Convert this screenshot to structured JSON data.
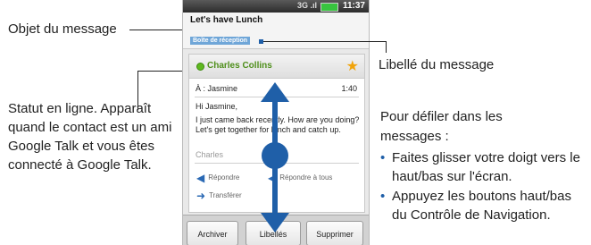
{
  "phone": {
    "status": {
      "clock": "11:37",
      "signal": "3G"
    },
    "subject": "Let's have Lunch",
    "label": "Boîte de réception",
    "sender": "Charles Collins",
    "to": "À : Jasmine",
    "time": "1:40",
    "greeting": "Hi Jasmine,",
    "body": "I just came back recently. How are you doing? Let's get together for lunch and catch up.",
    "signature": "Charles",
    "actions": {
      "reply": "Répondre",
      "reply_all": "Répondre à tous",
      "forward": "Transférer"
    },
    "buttons": {
      "archive": "Archiver",
      "labels": "Libellés",
      "delete": "Supprimer"
    }
  },
  "callouts": {
    "subject": "Objet du message",
    "label": "Libellé du message",
    "status": "Statut en ligne. Apparaît quand le contact est un ami Google Talk et vous êtes connecté à Google Talk.",
    "scroll_intro": "Pour défiler dans les messages :",
    "scroll_items": [
      "Faites glisser votre doigt vers le haut/bas sur l'écran.",
      "Appuyez les boutons haut/bas du Contrôle de Navigation."
    ]
  },
  "colors": {
    "online": "#5fb91f",
    "label_chip": "#6fa6d8",
    "arrow": "#1f5fa8",
    "star": "#f1a40b"
  }
}
